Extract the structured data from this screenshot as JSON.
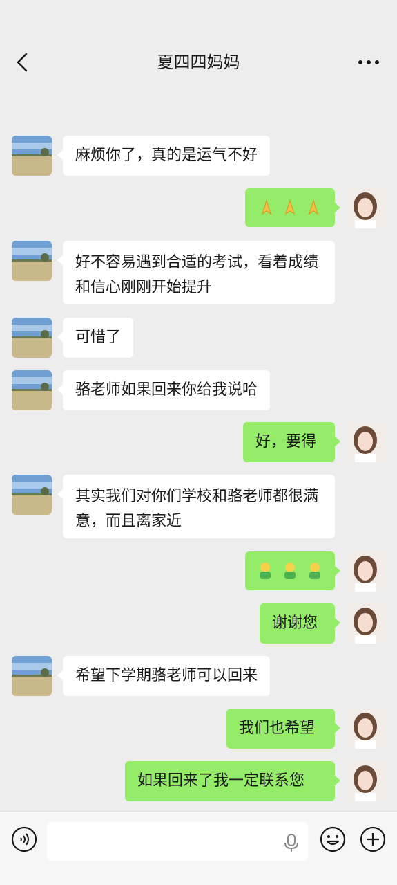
{
  "header": {
    "title": "夏四四妈妈"
  },
  "icons": {
    "back": "chevron-left-icon",
    "more": "more-horizontal-icon",
    "voice": "voice-icon",
    "mic": "microphone-icon",
    "emoji": "emoji-icon",
    "plus": "plus-icon"
  },
  "messages": [
    {
      "side": "in",
      "text": "麻烦你了，真的是运气不好"
    },
    {
      "side": "out",
      "emoji": "pray-emoji x3"
    },
    {
      "side": "in",
      "text": "好不容易遇到合适的考试，看着成绩和信心刚刚开始提升"
    },
    {
      "side": "in",
      "text": "可惜了"
    },
    {
      "side": "in",
      "text": "骆老师如果回来你给我说哈"
    },
    {
      "side": "out",
      "text": "好，要得"
    },
    {
      "side": "in",
      "text": "其实我们对你们学校和骆老师都很满意，而且离家近"
    },
    {
      "side": "out",
      "emoji": "thanks-emoji x3"
    },
    {
      "side": "out",
      "text": "谢谢您"
    },
    {
      "side": "in",
      "text": "希望下学期骆老师可以回来"
    },
    {
      "side": "out",
      "text": "我们也希望"
    },
    {
      "side": "out",
      "text": "如果回来了我一定联系您"
    }
  ],
  "input": {
    "value": ""
  },
  "colors": {
    "background": "#ededed",
    "incoming_bubble": "#ffffff",
    "outgoing_bubble": "#95ec69",
    "footer": "#f6f6f6"
  }
}
